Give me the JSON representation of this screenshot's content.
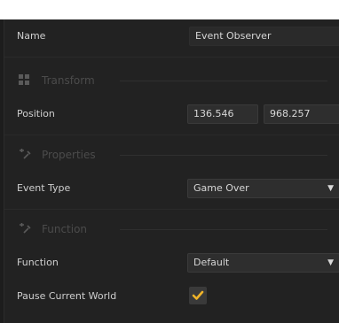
{
  "header": {
    "title": ""
  },
  "name_row": {
    "label": "Name",
    "value": "Event Observer"
  },
  "transform": {
    "section_title": "Transform",
    "position_label": "Position",
    "x": "136.546",
    "y": "968.257"
  },
  "properties": {
    "section_title": "Properties",
    "event_type_label": "Event Type",
    "event_type_value": "Game Over"
  },
  "function_section": {
    "section_title": "Function",
    "function_label": "Function",
    "function_value": "Default",
    "pause_label": "Pause Current World",
    "pause_checked": true
  },
  "colors": {
    "accent": "#f0b429",
    "panel": "#222222",
    "field": "#2e2e2e"
  },
  "icons": {
    "transform": "grid-icon",
    "properties": "wrench-icon",
    "function": "function-icon",
    "dropdown": "chevron-down-icon",
    "check": "check-icon"
  }
}
